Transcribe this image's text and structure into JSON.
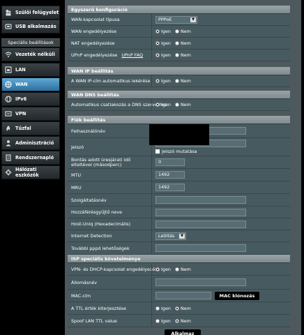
{
  "sidebar": {
    "top_items": [
      {
        "label": "Szülői felügyelet",
        "icon": "parental-icon"
      },
      {
        "label": "USB alkalmazás",
        "icon": "usb-icon"
      }
    ],
    "section_label": "Speciális beállítások",
    "items": [
      {
        "label": "Vezeték nélküli",
        "icon": "wireless-icon"
      },
      {
        "label": "LAN",
        "icon": "lan-icon"
      },
      {
        "label": "WAN",
        "icon": "wan-icon",
        "active": true
      },
      {
        "label": "IPv6",
        "icon": "ipv6-icon"
      },
      {
        "label": "VPN",
        "icon": "vpn-icon"
      },
      {
        "label": "Tűzfal",
        "icon": "firewall-icon"
      },
      {
        "label": "Adminisztráció",
        "icon": "admin-icon"
      },
      {
        "label": "Rendszernapló",
        "icon": "log-icon"
      },
      {
        "label": "Hálózati eszközök",
        "icon": "tools-icon"
      }
    ]
  },
  "radio": {
    "yes": "Igen",
    "no": "Nem"
  },
  "basic": {
    "title": "Egyszerű konfiguráció",
    "conn_type_label": "WAN-kapcsolat típusa",
    "conn_type_value": "PPPoE",
    "wan_enable_label": "WAN engedélyezése",
    "nat_enable_label": "NAT engedélyezése",
    "upnp_label": "UPnP engedélyezése",
    "upnp_link": "UPnP  FAQ"
  },
  "wan_ip": {
    "title": "WAN IP beállítás",
    "auto_label": "A WAN IP-cím automatikus lekérése"
  },
  "wan_dns": {
    "title": "WAN DNS beállítás",
    "auto_label": "Automatikus csatlakozás a DNS szerverhez"
  },
  "account": {
    "title": "Fiók beállítás",
    "username_label": "Felhasználónév",
    "password_label": "Jelszó",
    "show_password_label": "Jelszó mutatása",
    "idle_label": "Bontás adott üresjárati idő elteltével (másodperc)",
    "idle_value": "0",
    "mtu_label": "MTU",
    "mtu_value": "1492",
    "mru_label": "MRU",
    "mru_value": "1492",
    "service_label": "Szolgáltatásnév",
    "ac_label": "Hozzáférésgyűjtő neve",
    "host_uniq_label": "Host-Uniq (Hexadecimális)",
    "detection_label": "Internet Detection",
    "detection_value": "Letiltás",
    "pppd_label": "További pppd lehetőségek"
  },
  "isp": {
    "title": "ISP speciális követelménye",
    "vpn_dhcp_label": "VPN- és DHCP-kapcsolat engedélyezése",
    "hostname_label": "Állomásnév",
    "mac_label": "MAC-cím",
    "mac_clone_button": "MAC klónozás",
    "ttl_label": "A TTL érték kiterjesztése",
    "spoof_label": "Spoof LAN TTL value"
  },
  "apply_button": "Alkalmaz"
}
